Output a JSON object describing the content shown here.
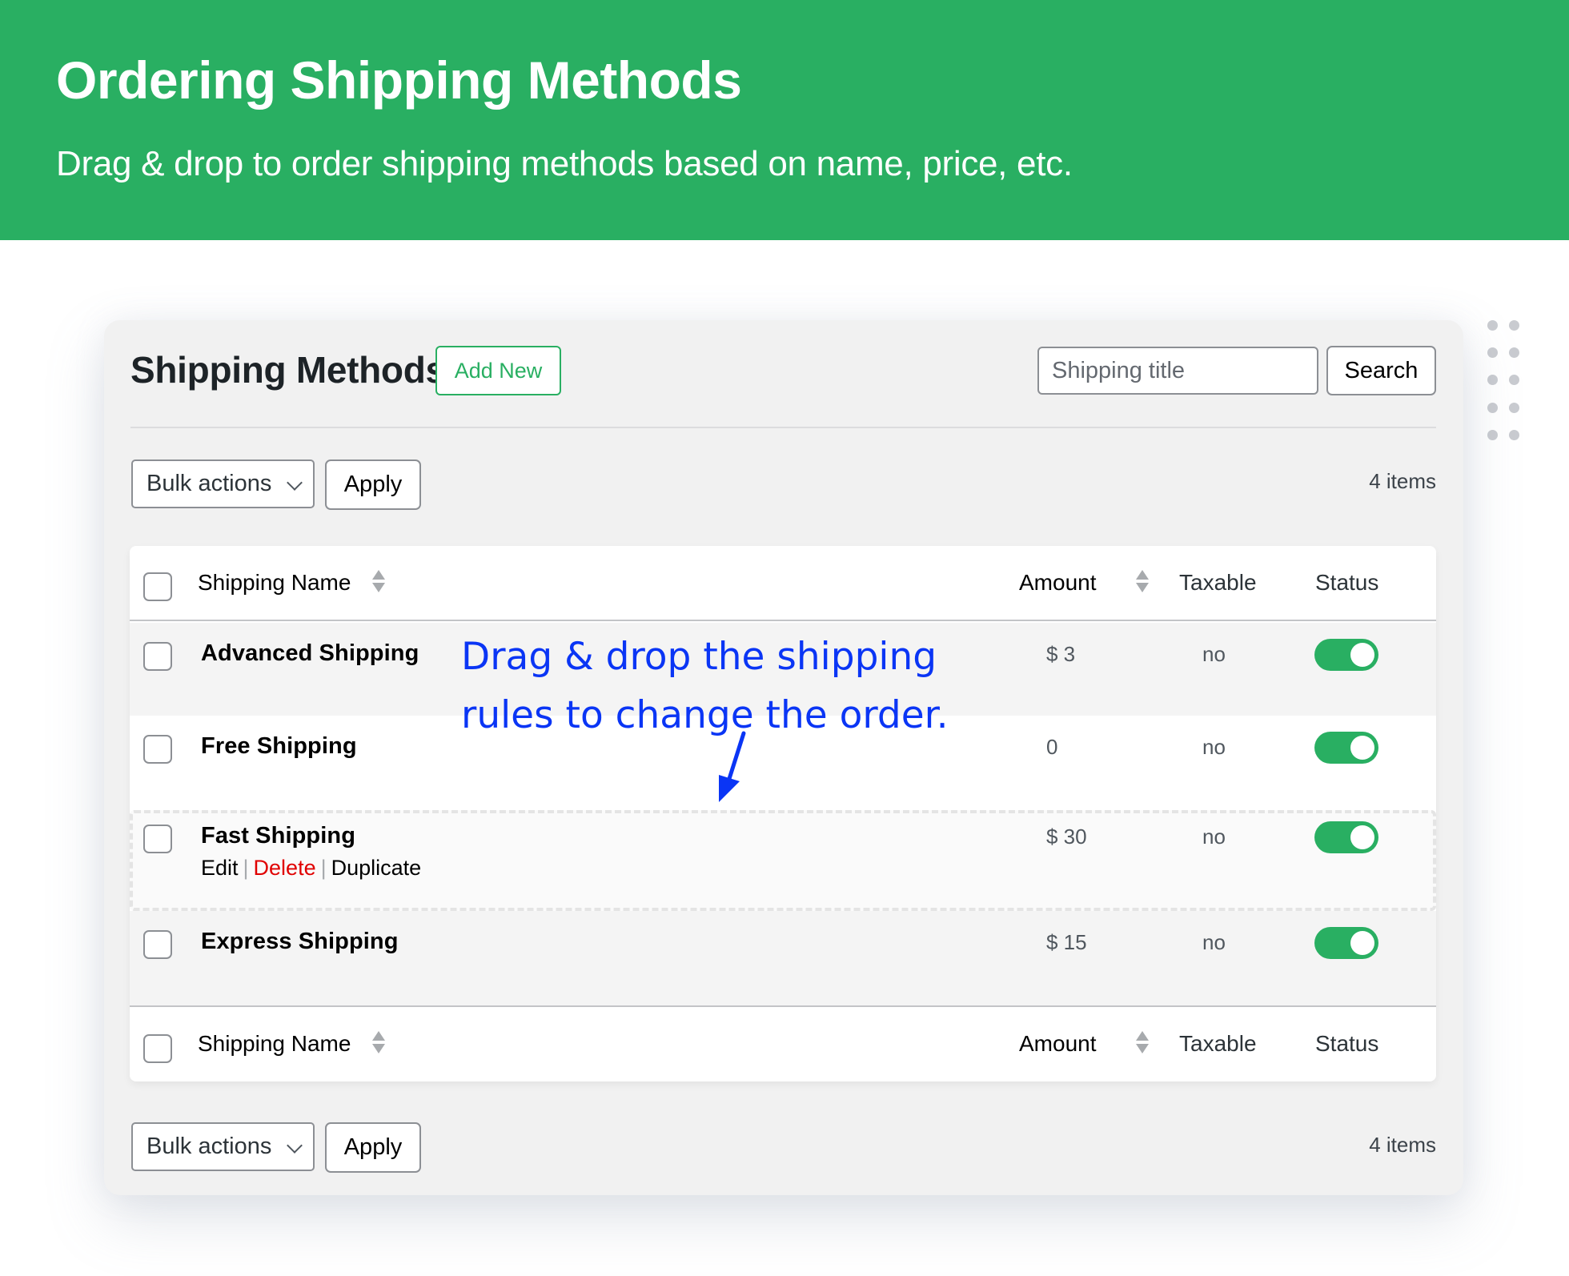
{
  "banner": {
    "title": "Ordering Shipping Methods",
    "subtitle": "Drag & drop to order shipping methods based on name, price, etc.",
    "color": "#29af62"
  },
  "page": {
    "title": "Shipping Methods",
    "add_new_label": "Add New",
    "search": {
      "placeholder": "Shipping title",
      "value": "",
      "button_label": "Search"
    }
  },
  "toolbar_top": {
    "bulk_actions_label": "Bulk actions",
    "apply_label": "Apply",
    "items_count": "4 items"
  },
  "toolbar_bottom": {
    "bulk_actions_label": "Bulk actions",
    "apply_label": "Apply",
    "items_count": "4 items"
  },
  "table": {
    "columns": {
      "name": "Shipping Name",
      "amount": "Amount",
      "taxable": "Taxable",
      "status": "Status"
    },
    "rows": [
      {
        "name": "Advanced Shipping",
        "amount": "$ 3",
        "taxable": "no",
        "status_enabled": true
      },
      {
        "name": "Free Shipping",
        "amount": "0",
        "taxable": "no",
        "status_enabled": true
      },
      {
        "name": "Fast Shipping",
        "amount": "$ 30",
        "taxable": "no",
        "status_enabled": true,
        "dragging": true,
        "actions": {
          "edit": "Edit",
          "delete": "Delete",
          "duplicate": "Duplicate",
          "separator": "|"
        }
      },
      {
        "name": "Express Shipping",
        "amount": "$ 15",
        "taxable": "no",
        "status_enabled": true
      }
    ]
  },
  "annotation": {
    "line1": "Drag & drop the shipping",
    "line2": "rules to change the order.",
    "color": "#0a35f5"
  }
}
